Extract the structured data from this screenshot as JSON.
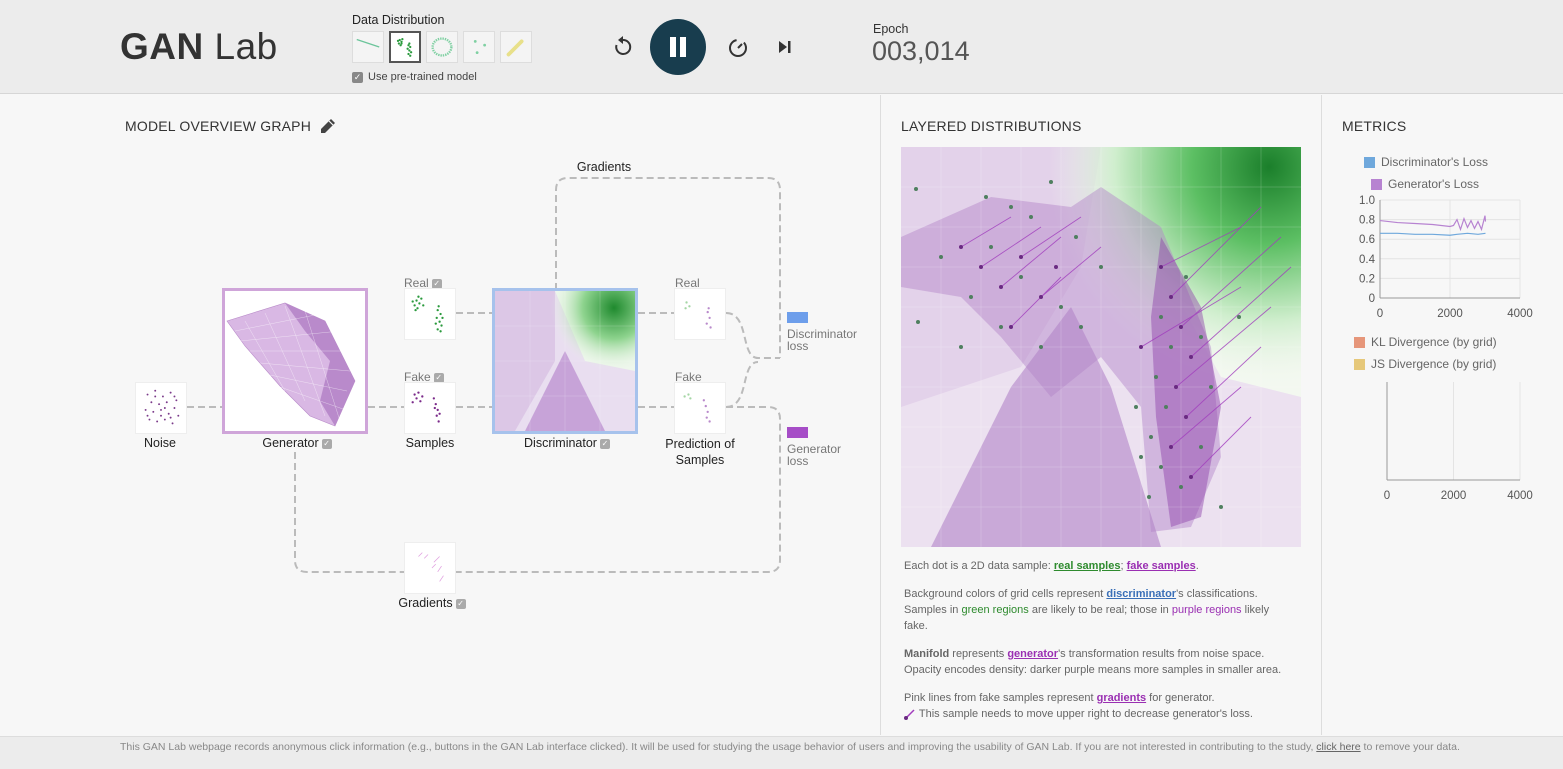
{
  "header": {
    "logo_bold": "GAN",
    "logo_rest": " Lab",
    "data_distribution_label": "Data Distribution",
    "use_pretrained_label": "Use pre-trained model",
    "epoch_label": "Epoch",
    "epoch_value": "003,014",
    "controls": [
      "reset-icon",
      "pause-icon",
      "speed-icon",
      "step-icon"
    ]
  },
  "model_overview": {
    "title": "MODEL OVERVIEW GRAPH",
    "gradients_top_label": "Gradients",
    "noise_label": "Noise",
    "generator_label": "Generator",
    "real_label": "Real",
    "fake_label": "Fake",
    "samples_label": "Samples",
    "discriminator_label": "Discriminator",
    "prediction_real_label": "Real",
    "prediction_fake_label": "Fake",
    "prediction_label": "Prediction of Samples",
    "gradients_bottom_label": "Gradients",
    "disc_loss_label": "Discriminator loss",
    "gen_loss_label": "Generator loss",
    "disc_loss_color": "#6d9eeb",
    "gen_loss_color": "#a64dc7"
  },
  "layered": {
    "title": "LAYERED DISTRIBUTIONS",
    "p1_pre": "Each dot is a 2D data sample: ",
    "p1_real": "real samples",
    "p1_sep": "; ",
    "p1_fake": "fake samples",
    "p1_end": ".",
    "p2_pre": "Background colors of grid cells represent ",
    "p2_link": "discriminator",
    "p2_mid": "'s classifications. Samples in ",
    "p2_green": "green regions",
    "p2_mid2": " are likely to be real; those in ",
    "p2_purple": "purple regions",
    "p2_end": " likely fake.",
    "p3_bold": "Manifold",
    "p3_mid": " represents ",
    "p3_link": "generator",
    "p3_end": "'s transformation results from noise space. Opacity encodes density: darker purple means more samples in smaller area.",
    "p4_pre": "Pink lines from fake samples represent ",
    "p4_link": "gradients",
    "p4_end": " for generator.",
    "p5": "This sample needs to move upper right to decrease generator's loss."
  },
  "metrics": {
    "title": "METRICS",
    "disc_loss_legend": "Discriminator's Loss",
    "gen_loss_legend": "Generator's Loss",
    "kl_legend": "KL Divergence (by grid)",
    "js_legend": "JS Divergence (by grid)",
    "disc_color": "#6fa8dc",
    "gen_color": "#b783d1",
    "kl_color": "#e6967a",
    "js_color": "#e6c87a",
    "loss_y_ticks": [
      "1.0",
      "0.8",
      "0.6",
      "0.4",
      "0.2",
      "0"
    ],
    "x_ticks": [
      "0",
      "2000",
      "4000"
    ]
  },
  "chart_data": {
    "type": "line",
    "xlabel": "",
    "ylabel": "",
    "xlim": [
      0,
      4000
    ],
    "ylim": [
      0,
      1.0
    ],
    "series": [
      {
        "name": "Discriminator's Loss",
        "x": [
          0,
          500,
          1000,
          1500,
          2000,
          2200,
          2500,
          2800,
          3014
        ],
        "values": [
          0.66,
          0.66,
          0.65,
          0.65,
          0.64,
          0.65,
          0.66,
          0.65,
          0.66
        ]
      },
      {
        "name": "Generator's Loss",
        "x": [
          0,
          500,
          1000,
          1500,
          2000,
          2100,
          2200,
          2300,
          2400,
          2500,
          2600,
          2700,
          2800,
          2900,
          3000,
          3014
        ],
        "values": [
          0.79,
          0.77,
          0.76,
          0.75,
          0.73,
          0.74,
          0.8,
          0.7,
          0.81,
          0.72,
          0.79,
          0.71,
          0.78,
          0.7,
          0.84,
          0.78
        ]
      }
    ]
  },
  "footer": {
    "text_pre": "This GAN Lab webpage records anonymous click information (e.g., buttons in the GAN Lab interface clicked). It will be used for studying the usage behavior of users and improving the usability of GAN Lab. If you are not interested in contributing to the study, ",
    "link": "click here",
    "text_post": " to remove your data."
  }
}
